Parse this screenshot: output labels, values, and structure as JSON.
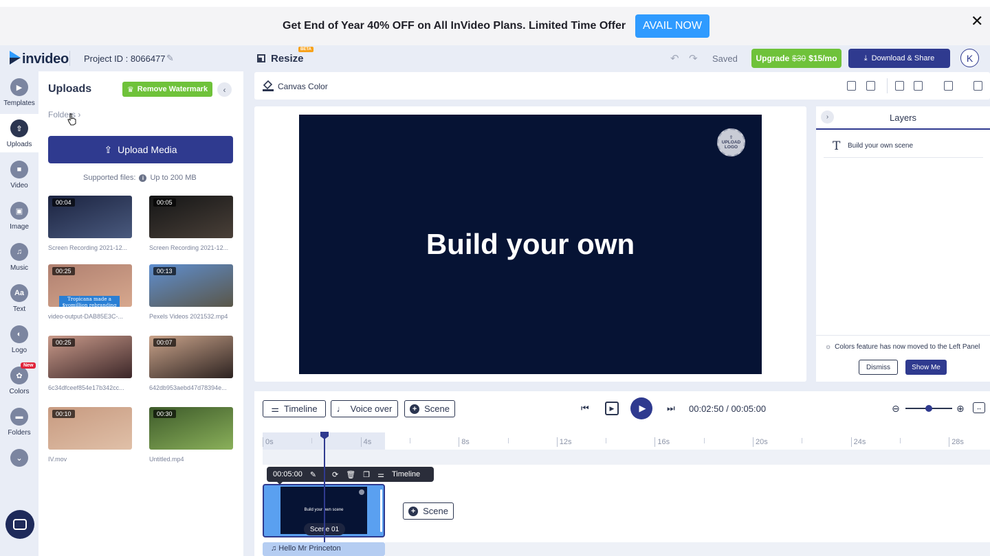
{
  "banner": {
    "text": "Get End of Year 40% OFF on All InVideo Plans. Limited Time Offer",
    "cta_label": "AVAIL NOW",
    "close_glyph": "✕"
  },
  "header": {
    "logo_text": "invideo",
    "project_id": "Project ID : 8066477",
    "resize_label": "Resize",
    "beta_badge": "BETA",
    "saved_label": "Saved",
    "upgrade_label": "Upgrade",
    "upgrade_old_price": "$30",
    "upgrade_new_price": "$15/mo",
    "download_label": "Download & Share",
    "avatar_initial": "K"
  },
  "rail": {
    "items": [
      {
        "label": "Templates",
        "icon": "play-square-icon",
        "glyph": "▶"
      },
      {
        "label": "Uploads",
        "icon": "upload-icon",
        "glyph": "⇧"
      },
      {
        "label": "Video",
        "icon": "video-camera-icon",
        "glyph": "■"
      },
      {
        "label": "Image",
        "icon": "image-icon",
        "glyph": "▣"
      },
      {
        "label": "Music",
        "icon": "music-note-icon",
        "glyph": "♫"
      },
      {
        "label": "Text",
        "icon": "text-icon",
        "glyph": "Aa"
      },
      {
        "label": "Logo",
        "icon": "logo-icon",
        "glyph": "◐"
      },
      {
        "label": "Colors",
        "icon": "palette-icon",
        "glyph": "✿"
      },
      {
        "label": "Folders",
        "icon": "folder-icon",
        "glyph": "▬"
      }
    ],
    "more_glyph": "⌄",
    "new_badge": "New"
  },
  "uploads": {
    "title": "Uploads",
    "remove_watermark": "Remove Watermark",
    "folders_link": "Folders ›",
    "upload_media": "Upload Media",
    "supported_files": "Supported files:",
    "max_size": "Up to 200 MB",
    "media": [
      {
        "duration": "00:04",
        "name": "Screen Recording 2021-12...",
        "colors": [
          "#1b2340",
          "#4a5a7e"
        ]
      },
      {
        "duration": "00:05",
        "name": "Screen Recording 2021-12...",
        "colors": [
          "#141516",
          "#4a4038"
        ]
      },
      {
        "duration": "00:25",
        "name": "video-output-DAB85E3C-...",
        "colors": [
          "#b08070",
          "#d7a88e"
        ],
        "caption": "Tropicana made a $yomillion rebranding"
      },
      {
        "duration": "00:13",
        "name": "Pexels Videos 2021532.mp4",
        "colors": [
          "#5f8fd0",
          "#5a5648"
        ]
      },
      {
        "duration": "00:25",
        "name": "6c34dfceef854e17b342cc...",
        "colors": [
          "#c99a8a",
          "#3b2628"
        ]
      },
      {
        "duration": "00:07",
        "name": "642db953aebd47d78394e...",
        "colors": [
          "#c9a38a",
          "#2c2220"
        ]
      },
      {
        "duration": "00:10",
        "name": "IV.mov",
        "colors": [
          "#c79a80",
          "#e0c0a8"
        ]
      },
      {
        "duration": "00:30",
        "name": "Untitled.mp4",
        "colors": [
          "#3d5a2a",
          "#8ab05a"
        ]
      }
    ]
  },
  "canvas": {
    "color_label": "Canvas Color",
    "stage_text": "Build your own",
    "upload_logo": [
      "UPLOAD",
      "LOGO"
    ],
    "background": "#061334"
  },
  "layers": {
    "title": "Layers",
    "items": [
      {
        "icon": "T",
        "name": "Build your own scene"
      }
    ],
    "notice": "Colors feature has now moved to the Left Panel",
    "dismiss": "Dismiss",
    "show_me": "Show Me"
  },
  "timeline": {
    "timeline_btn": "Timeline",
    "voiceover_btn": "Voice over",
    "scene_btn": "Scene",
    "current_time": "00:02:50",
    "total_time": "00:05:00",
    "ticks": [
      "0s",
      "4s",
      "8s",
      "12s",
      "16s",
      "20s",
      "24s",
      "28s"
    ],
    "scene_duration": "00:05:00",
    "scene_toolbar_timeline": "Timeline",
    "scene_thumb_text": "Build your own scene",
    "scene_label": "Scene 01",
    "add_scene": "Scene",
    "audio_clip": "♫ Hello Mr Princeton"
  }
}
